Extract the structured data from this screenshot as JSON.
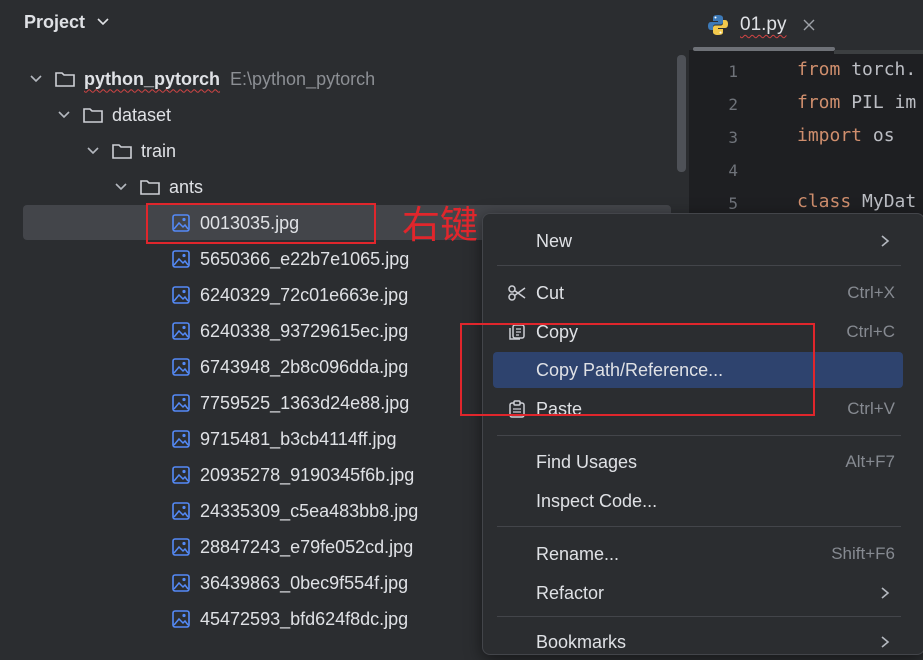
{
  "panel": {
    "title": "Project"
  },
  "tree": {
    "root": {
      "label": "python_pytorch",
      "path": "E:\\python_pytorch"
    },
    "dataset": "dataset",
    "train": "train",
    "ants": "ants",
    "files": [
      "0013035.jpg",
      "5650366_e22b7e1065.jpg",
      "6240329_72c01e663e.jpg",
      "6240338_93729615ec.jpg",
      "6743948_2b8c096dda.jpg",
      "7759525_1363d24e88.jpg",
      "9715481_b3cb4114ff.jpg",
      "20935278_9190345f6b.jpg",
      "24335309_c5ea483bb8.jpg",
      "28847243_e79fe052cd.jpg",
      "36439863_0bec9f554f.jpg",
      "45472593_bfd624f8dc.jpg"
    ]
  },
  "editor": {
    "tab_label": "01.py",
    "line_numbers": [
      "1",
      "2",
      "3",
      "4",
      "5"
    ],
    "lines": [
      {
        "kw": "from",
        "rest": " torch."
      },
      {
        "kw": "from",
        "rest": " PIL im"
      },
      {
        "kw": "import",
        "rest": " os"
      },
      {
        "kw": "",
        "rest": ""
      },
      {
        "kw": "class",
        "rest": " MyDat"
      }
    ]
  },
  "context_menu": {
    "new": {
      "label": "New"
    },
    "cut": {
      "label": "Cut",
      "shortcut": "Ctrl+X"
    },
    "copy": {
      "label": "Copy",
      "shortcut": "Ctrl+C"
    },
    "copy_path": {
      "label": "Copy Path/Reference..."
    },
    "paste": {
      "label": "Paste",
      "shortcut": "Ctrl+V"
    },
    "find_usages": {
      "label": "Find Usages",
      "shortcut": "Alt+F7"
    },
    "inspect_code": {
      "label": "Inspect Code..."
    },
    "rename": {
      "label": "Rename...",
      "shortcut": "Shift+F6"
    },
    "refactor": {
      "label": "Refactor"
    },
    "bookmarks": {
      "label": "Bookmarks"
    }
  },
  "annotation": {
    "text": "右键"
  },
  "colors": {
    "accent_highlight": "#2e436e",
    "annotation_red": "#e0262c",
    "keyword": "#cf8e6d"
  }
}
